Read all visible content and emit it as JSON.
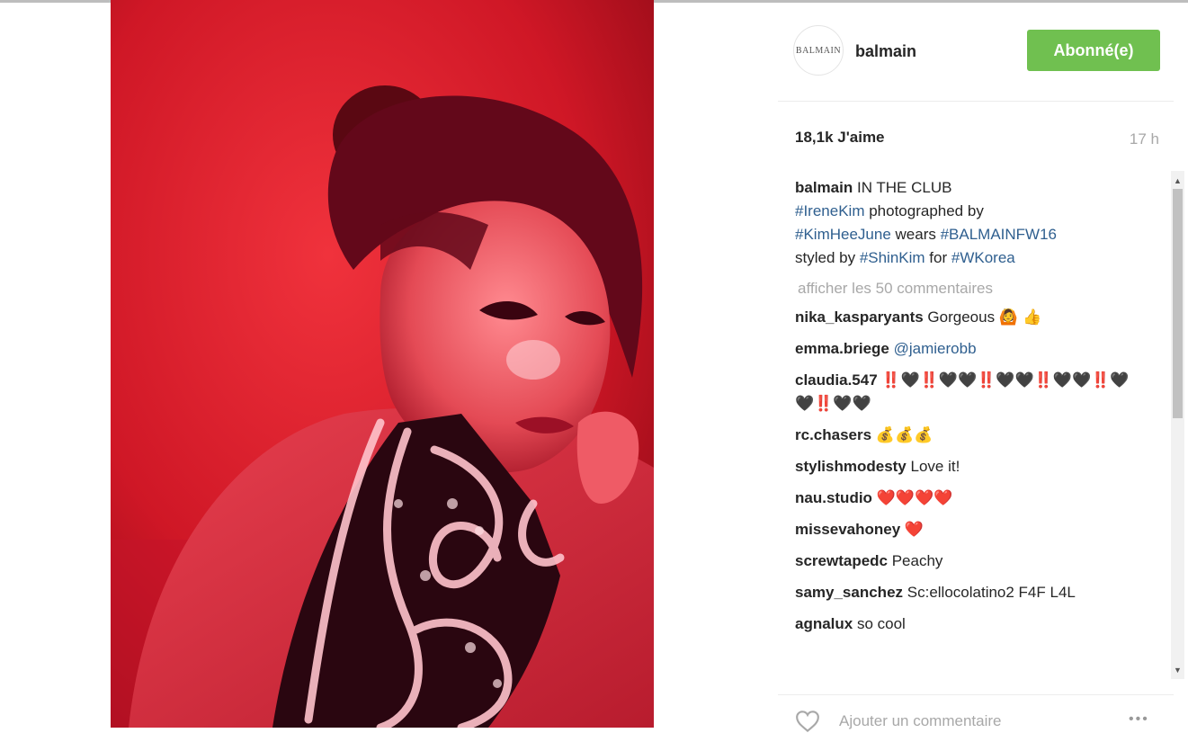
{
  "post": {
    "image_alt": "Red-lit portrait photograph",
    "author": "balmain",
    "avatar_text": "BALMAIN",
    "follow_label": "Abonné(e)",
    "likes": "18,1k J'aime",
    "time": "17 h",
    "caption": {
      "user": "balmain",
      "text_1": " IN THE CLUB",
      "tag_1": "#IreneKim",
      "text_2": " photographed by",
      "tag_2": "#KimHeeJune",
      "text_3": " wears ",
      "tag_3": "#BALMAINFW16",
      "text_4": "styled by ",
      "tag_4": "#ShinKim",
      "text_5": " for ",
      "tag_5": "#WKorea"
    },
    "load_more": "afficher les 50 commentaires",
    "comments": [
      {
        "user": "nika_kasparyants",
        "text": " Gorgeous ",
        "emoji": "🙆 👍"
      },
      {
        "user": "emma.briege",
        "text": " ",
        "mention": "@jamierobb"
      },
      {
        "user": "claudia.547",
        "text": " ",
        "emoji": "‼️🖤‼️🖤🖤‼️🖤🖤‼️🖤🖤‼️🖤🖤‼️🖤🖤"
      },
      {
        "user": "rc.chasers",
        "text": " ",
        "emoji": "💰💰💰"
      },
      {
        "user": "stylishmodesty",
        "text": " Love it!"
      },
      {
        "user": "nau.studio",
        "text": " ",
        "emoji": "❤️❤️❤️❤️"
      },
      {
        "user": "missevahoney",
        "text": " ",
        "emoji": "❤️"
      },
      {
        "user": "screwtapedc",
        "text": " Peachy"
      },
      {
        "user": "samy_sanchez",
        "text": " Sc:ellocolatino2 F4F L4L"
      },
      {
        "user": "agnalux",
        "text": " so cool"
      }
    ],
    "add_comment_placeholder": "Ajouter un commentaire",
    "more_options": "•••"
  },
  "colors": {
    "follow_green": "#70c050",
    "link_blue": "#2f5f8f",
    "photo_red": "#d8172b"
  },
  "icons": [
    "heart-icon",
    "more-options-icon",
    "scroll-up-icon",
    "scroll-down-icon"
  ]
}
